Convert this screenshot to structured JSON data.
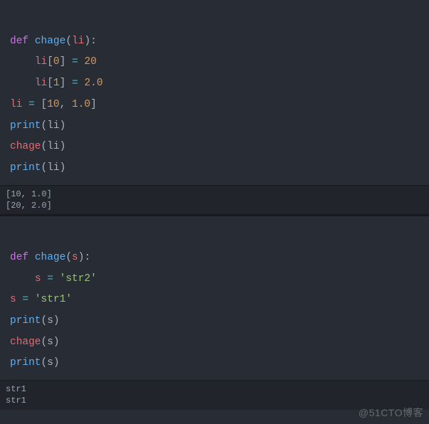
{
  "block1": {
    "l1": {
      "def": "def",
      "fn": "chage",
      "paramOpen": "(",
      "param": "li",
      "paramClose": ")",
      "colon": ":"
    },
    "l2": {
      "indent": "    ",
      "var": "li",
      "bOpen": "[",
      "idx": "0",
      "bClose": "]",
      "sp1": " ",
      "op": "=",
      "sp2": " ",
      "val": "20"
    },
    "l3": {
      "indent": "    ",
      "var": "li",
      "bOpen": "[",
      "idx": "1",
      "bClose": "]",
      "sp1": " ",
      "op": "=",
      "sp2": " ",
      "val": "2.0"
    },
    "l4": {
      "var": "li",
      "sp1": " ",
      "op": "=",
      "sp2": " ",
      "bOpen": "[",
      "v1": "10",
      "comma": ",",
      "sp3": " ",
      "v2": "1.0",
      "bClose": "]"
    },
    "l5": {
      "fn": "print",
      "pOpen": "(",
      "arg": "li",
      "pClose": ")"
    },
    "l6": {
      "fn": "chage",
      "pOpen": "(",
      "arg": "li",
      "pClose": ")"
    },
    "l7": {
      "fn": "print",
      "pOpen": "(",
      "arg": "li",
      "pClose": ")"
    }
  },
  "output1": {
    "line1": "[10, 1.0]",
    "line2": "[20, 2.0]"
  },
  "block2": {
    "l1": {
      "def": "def",
      "fn": "chage",
      "paramOpen": "(",
      "param": "s",
      "paramClose": ")",
      "colon": ":"
    },
    "l2": {
      "indent": "    ",
      "var": "s",
      "sp1": " ",
      "op": "=",
      "sp2": " ",
      "val": "'str2'"
    },
    "l3": {
      "var": "s",
      "sp1": " ",
      "op": "=",
      "sp2": " ",
      "val": "'str1'"
    },
    "l4": {
      "fn": "print",
      "pOpen": "(",
      "arg": "s",
      "pClose": ")"
    },
    "l5": {
      "fn": "chage",
      "pOpen": "(",
      "arg": "s",
      "pClose": ")"
    },
    "l6": {
      "fn": "print",
      "pOpen": "(",
      "arg": "s",
      "pClose": ")"
    }
  },
  "output2": {
    "line1": "str1",
    "line2": "str1"
  },
  "watermark": "@51CTO博客"
}
